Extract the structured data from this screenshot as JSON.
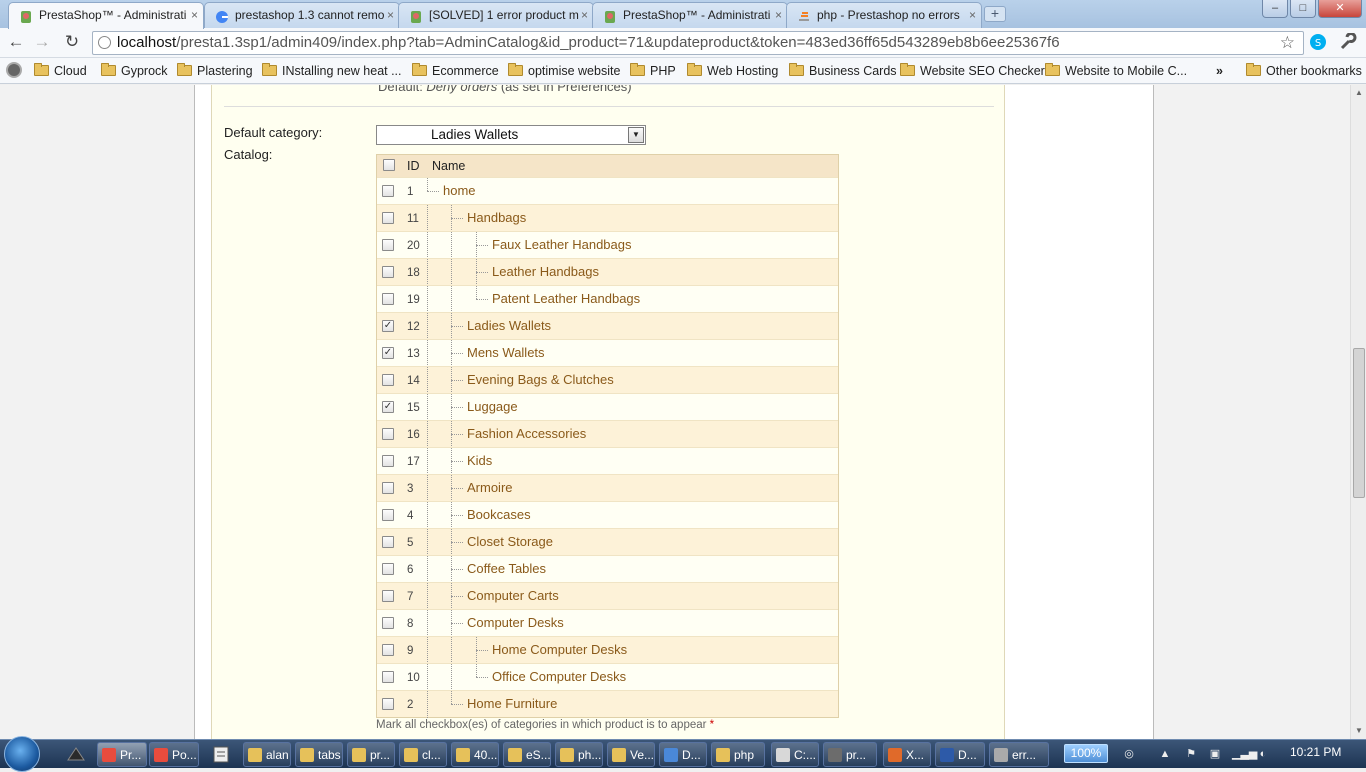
{
  "browser": {
    "tabs": [
      {
        "title": "PrestaShop™ - Administrati",
        "active": true
      },
      {
        "title": "prestashop 1.3 cannot remo",
        "active": false
      },
      {
        "title": "[SOLVED] 1 error product m",
        "active": false
      },
      {
        "title": "PrestaShop™ - Administrati",
        "active": false
      },
      {
        "title": "php - Prestashop no errors",
        "active": false
      }
    ],
    "tab_close": "×",
    "newtab": "+",
    "window_buttons": {
      "minimize": "–",
      "maximize": "□",
      "close": "✕"
    },
    "nav": {
      "back": "←",
      "forward": "→",
      "reload": "↻"
    },
    "url": {
      "host": "localhost",
      "path": "/presta1.3sp1/admin409/index.php?tab=AdminCatalog&id_product=71&updateproduct&token=483ed36ff65d543289eb8b6ee25367f6"
    },
    "star": "☆",
    "bookmarks": [
      {
        "label": "Cloud"
      },
      {
        "label": "Gyprock"
      },
      {
        "label": "Plastering"
      },
      {
        "label": "INstalling new heat ..."
      },
      {
        "label": "Ecommerce"
      },
      {
        "label": "optimise website"
      },
      {
        "label": "PHP"
      },
      {
        "label": "Web Hosting"
      },
      {
        "label": "Business Cards"
      },
      {
        "label": "Website SEO Checker"
      },
      {
        "label": "Website to Mobile C..."
      }
    ],
    "bookmarks_overflow": "»",
    "other_bookmarks": "Other bookmarks"
  },
  "form": {
    "cut_prefix": "Default: ",
    "cut_italic": "Deny orders",
    "cut_suffix": " (as set in Preferences)",
    "default_category_label": "Default category:",
    "default_category_value": "Ladies Wallets",
    "catalog_label": "Catalog:",
    "table_header": {
      "id": "ID",
      "name": "Name"
    },
    "categories": [
      {
        "id": "1",
        "name": "home",
        "level": 0,
        "checked": false
      },
      {
        "id": "11",
        "name": "Handbags",
        "level": 1,
        "checked": false
      },
      {
        "id": "20",
        "name": "Faux Leather Handbags",
        "level": 2,
        "checked": false
      },
      {
        "id": "18",
        "name": "Leather Handbags",
        "level": 2,
        "checked": false
      },
      {
        "id": "19",
        "name": "Patent Leather Handbags",
        "level": 2,
        "checked": false
      },
      {
        "id": "12",
        "name": "Ladies Wallets",
        "level": 1,
        "checked": true
      },
      {
        "id": "13",
        "name": "Mens Wallets",
        "level": 1,
        "checked": true
      },
      {
        "id": "14",
        "name": "Evening Bags & Clutches",
        "level": 1,
        "checked": false
      },
      {
        "id": "15",
        "name": "Luggage",
        "level": 1,
        "checked": true
      },
      {
        "id": "16",
        "name": "Fashion Accessories",
        "level": 1,
        "checked": false
      },
      {
        "id": "17",
        "name": "Kids",
        "level": 1,
        "checked": false
      },
      {
        "id": "3",
        "name": "Armoire",
        "level": 1,
        "checked": false
      },
      {
        "id": "4",
        "name": "Bookcases",
        "level": 1,
        "checked": false
      },
      {
        "id": "5",
        "name": "Closet Storage",
        "level": 1,
        "checked": false
      },
      {
        "id": "6",
        "name": "Coffee Tables",
        "level": 1,
        "checked": false
      },
      {
        "id": "7",
        "name": "Computer Carts",
        "level": 1,
        "checked": false
      },
      {
        "id": "8",
        "name": "Computer Desks",
        "level": 1,
        "checked": false
      },
      {
        "id": "9",
        "name": "Home Computer Desks",
        "level": 2,
        "checked": false
      },
      {
        "id": "10",
        "name": "Office Computer Desks",
        "level": 2,
        "checked": false
      },
      {
        "id": "2",
        "name": "Home Furniture",
        "level": 1,
        "checked": false
      }
    ],
    "checkmark": "✓",
    "hint": "Mark all checkbox(es) of categories in which product is to appear",
    "hint_required": "*"
  },
  "taskbar": {
    "items": [
      {
        "label": "Pr...",
        "active": true
      },
      {
        "label": "Po...",
        "active": false
      },
      {
        "label": "alan",
        "active": false
      },
      {
        "label": "tabs",
        "active": false
      },
      {
        "label": "pr...",
        "active": false
      },
      {
        "label": "cl...",
        "active": false
      },
      {
        "label": "40...",
        "active": false
      },
      {
        "label": "eS...",
        "active": false
      },
      {
        "label": "ph...",
        "active": false
      },
      {
        "label": "Ve...",
        "active": false
      },
      {
        "label": "D...",
        "active": false
      },
      {
        "label": "php",
        "active": false
      },
      {
        "label": "C:...",
        "active": false
      },
      {
        "label": "pr...",
        "active": false
      },
      {
        "label": "X...",
        "active": false
      },
      {
        "label": "D...",
        "active": false
      },
      {
        "label": "err...",
        "active": false
      }
    ],
    "zoom": "100%",
    "clock": "10:21 PM"
  },
  "colors": {
    "accent_link": "#8a5a1a",
    "header_bg": "#f5e5c8",
    "row_even": "#fdf2d8"
  }
}
